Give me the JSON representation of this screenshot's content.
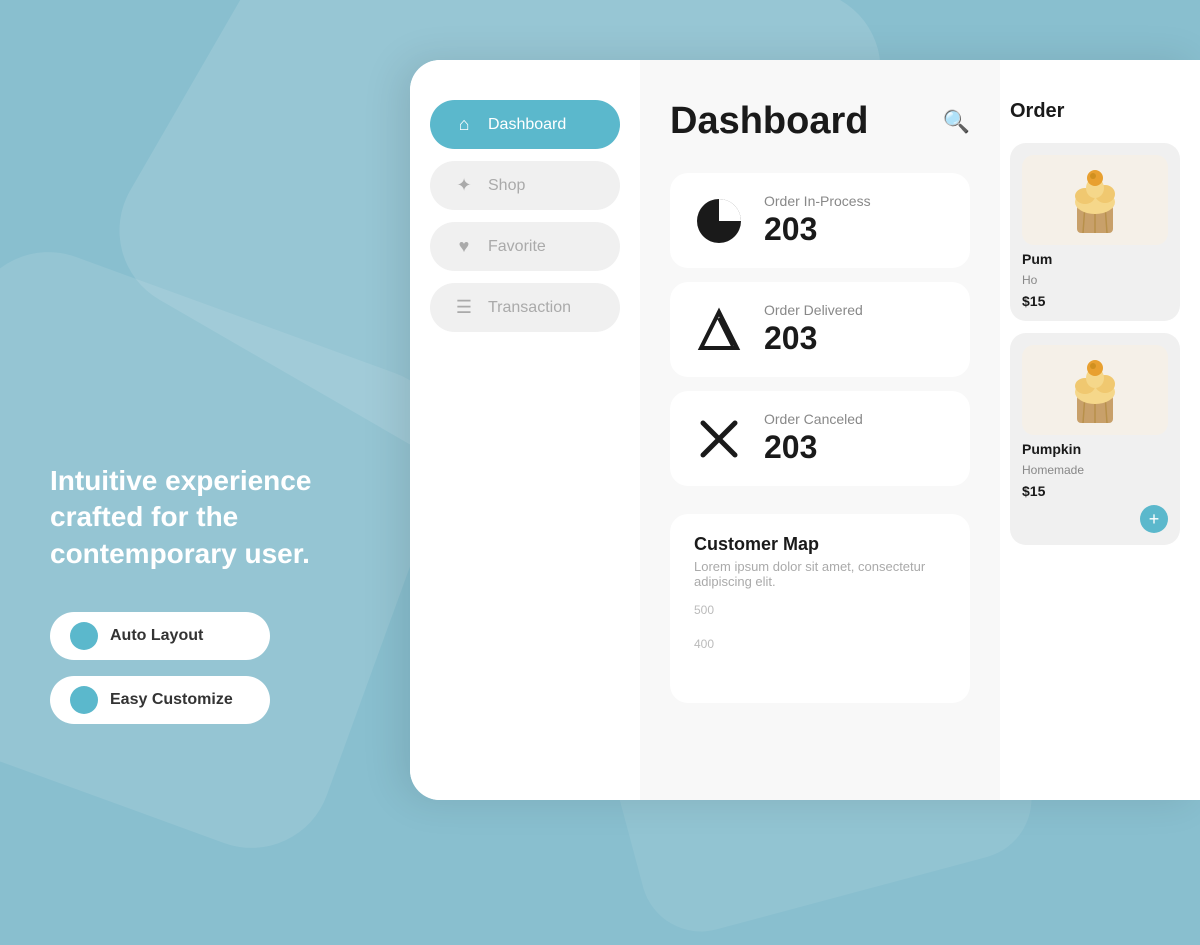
{
  "background": {
    "color": "#89bfcf"
  },
  "left": {
    "tagline": "Intuitive experience crafted for the contemporary user.",
    "features": [
      {
        "id": "auto-layout",
        "label": "Auto Layout"
      },
      {
        "id": "easy-customize",
        "label": "Easy Customize"
      }
    ]
  },
  "sidebar": {
    "items": [
      {
        "id": "dashboard",
        "label": "Dashboard",
        "icon": "⌂",
        "active": true
      },
      {
        "id": "shop",
        "label": "Shop",
        "icon": "✦",
        "active": false
      },
      {
        "id": "favorite",
        "label": "Favorite",
        "icon": "♥",
        "active": false
      },
      {
        "id": "transaction",
        "label": "Transaction",
        "icon": "≡",
        "active": false
      }
    ]
  },
  "header": {
    "title": "Dashboard",
    "search_icon": "🔍"
  },
  "stats": [
    {
      "id": "in-process",
      "label": "Order In-Process",
      "value": "203",
      "icon": "◑"
    },
    {
      "id": "delivered",
      "label": "Order Delivered",
      "value": "203",
      "icon": "➤"
    },
    {
      "id": "canceled",
      "label": "Order Canceled",
      "value": "203",
      "icon": "✕"
    }
  ],
  "customer_map": {
    "title": "Customer Map",
    "description": "Lorem ipsum dolor sit amet, consectetur adipiscing elit.",
    "chart_labels": [
      "500",
      "400"
    ]
  },
  "products": {
    "section_title": "Order",
    "items": [
      {
        "id": "product-1",
        "name": "Pum",
        "subtitle": "Ho",
        "price": "$15",
        "emoji": "🧁"
      },
      {
        "id": "product-2",
        "name": "Pumpkin",
        "subtitle": "Homemade",
        "price": "$15",
        "emoji": "🧁"
      }
    ]
  }
}
